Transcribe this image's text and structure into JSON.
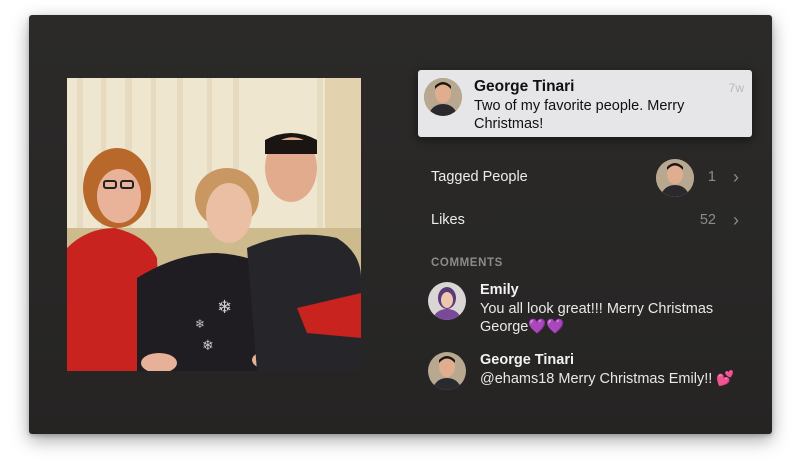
{
  "post": {
    "caption": {
      "author": "George Tinari",
      "time": "7w",
      "text": "Two of my favorite people. Merry Christmas!"
    },
    "tagged_people": {
      "label": "Tagged People",
      "count": "1",
      "chevron": "›"
    },
    "likes": {
      "label": "Likes",
      "count": "52",
      "chevron": "›"
    },
    "comments_title": "COMMENTS",
    "comments": [
      {
        "author": "Emily",
        "text": "You all look great!!! Merry Christmas George",
        "emoji": "💜💜"
      },
      {
        "author": "George Tinari",
        "text": "@ehams18 Merry Christmas Emily!!",
        "emoji": "💕"
      }
    ]
  },
  "icons": {
    "avatar_george": "avatar-icon",
    "avatar_emily": "avatar-icon",
    "chevron": "chevron-right-icon"
  },
  "colors": {
    "background": "#282726",
    "card": "#e6e6e8",
    "muted": "#8c8c8c",
    "heart": "#b040d8"
  }
}
